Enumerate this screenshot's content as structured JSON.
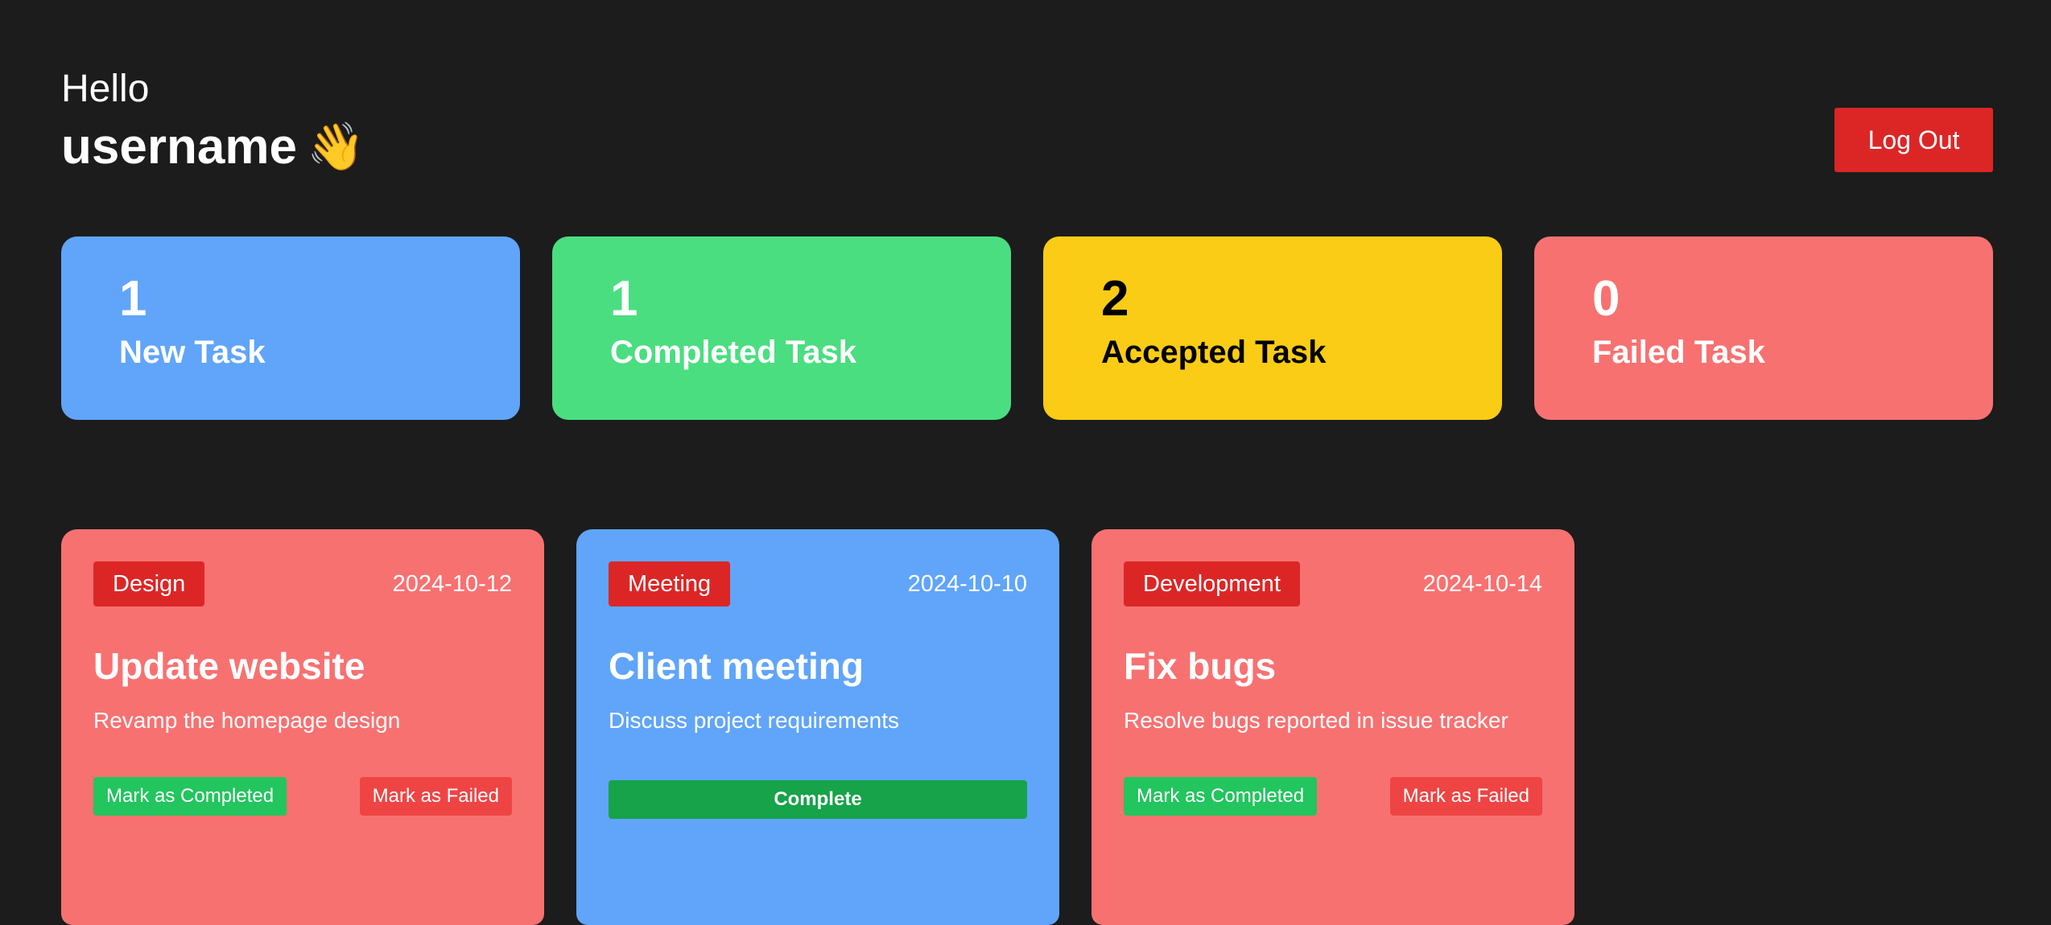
{
  "header": {
    "greeting": "Hello",
    "username": "username",
    "wave_emoji": "👋",
    "logout_label": "Log Out"
  },
  "stats": [
    {
      "count": "1",
      "label": "New Task",
      "bg": "#60a5fa",
      "fg": "#ffffff"
    },
    {
      "count": "1",
      "label": "Completed Task",
      "bg": "#4ade80",
      "fg": "#ffffff"
    },
    {
      "count": "2",
      "label": "Accepted Task",
      "bg": "#facc15",
      "fg": "#000000"
    },
    {
      "count": "0",
      "label": "Failed Task",
      "bg": "#f87171",
      "fg": "#ffffff"
    }
  ],
  "tasks": [
    {
      "category": "Design",
      "date": "2024-10-12",
      "title": "Update website",
      "description": "Revamp the homepage design",
      "bg": "#f87171",
      "complete_label": "Mark as Completed",
      "failed_label": "Mark as Failed"
    },
    {
      "category": "Meeting",
      "date": "2024-10-10",
      "title": "Client meeting",
      "description": "Discuss project requirements",
      "bg": "#60a5fa",
      "status_label": "Complete"
    },
    {
      "category": "Development",
      "date": "2024-10-14",
      "title": "Fix bugs",
      "description": "Resolve bugs reported in issue tracker",
      "bg": "#f87171",
      "complete_label": "Mark as Completed",
      "failed_label": "Mark as Failed"
    }
  ],
  "colors": {
    "background": "#1c1c1c",
    "danger": "#dc2626",
    "success": "#22c55e"
  }
}
